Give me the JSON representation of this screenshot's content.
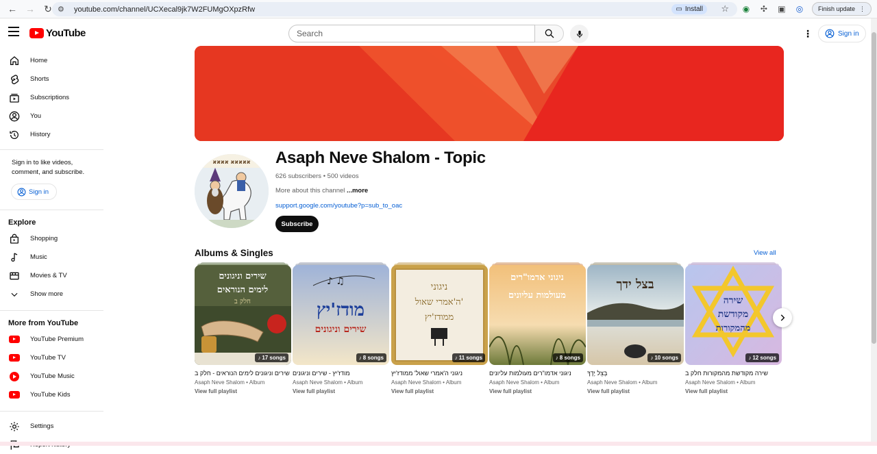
{
  "browser": {
    "url": "youtube.com/channel/UCXecal9jk7W2FUMgOXpzRfw",
    "install_label": "Install",
    "finish_update_label": "Finish update"
  },
  "header": {
    "logo_text": "YouTube",
    "search_placeholder": "Search",
    "signin_label": "Sign in"
  },
  "sidebar": {
    "main": [
      {
        "label": "Home",
        "icon": "home-icon"
      },
      {
        "label": "Shorts",
        "icon": "shorts-icon"
      },
      {
        "label": "Subscriptions",
        "icon": "subscriptions-icon"
      },
      {
        "label": "You",
        "icon": "you-icon"
      },
      {
        "label": "History",
        "icon": "history-icon"
      }
    ],
    "signin_note": "Sign in to like videos, comment, and subscribe.",
    "signin_label": "Sign in",
    "explore_heading": "Explore",
    "explore": [
      {
        "label": "Shopping",
        "icon": "shopping-icon"
      },
      {
        "label": "Music",
        "icon": "music-icon"
      },
      {
        "label": "Movies & TV",
        "icon": "movies-icon"
      },
      {
        "label": "Show more",
        "icon": "chevron-down-icon"
      }
    ],
    "more_heading": "More from YouTube",
    "more": [
      {
        "label": "YouTube Premium"
      },
      {
        "label": "YouTube TV"
      },
      {
        "label": "YouTube Music"
      },
      {
        "label": "YouTube Kids"
      }
    ],
    "bottom": [
      {
        "label": "Settings",
        "icon": "gear-icon"
      },
      {
        "label": "Report history",
        "icon": "flag-icon"
      }
    ]
  },
  "channel": {
    "name": "Asaph Neve Shalom - Topic",
    "meta": "626 subscribers • 500 videos",
    "description": "More about this channel",
    "more_label": "...more",
    "link": "support.google.com/youtube?p=sub_to_oac",
    "subscribe_label": "Subscribe"
  },
  "albums": {
    "title": "Albums & Singles",
    "view_all": "View all",
    "items": [
      {
        "title": "שירים וניגונים לימים הנוראים - חלק ב",
        "subtitle": "Asaph Neve Shalom • Album",
        "link": "View full playlist",
        "songs": "17 songs",
        "thumb_text_1": "שירים וניגונים",
        "thumb_text_2": "לימים הנוראים",
        "thumb_text_3": "חלק ב"
      },
      {
        "title": "מודז'יץ - שירים וניגונים",
        "subtitle": "Asaph Neve Shalom • Album",
        "link": "View full playlist",
        "songs": "8 songs",
        "thumb_text_1": "מודז'יץ",
        "thumb_text_2": "שירים וניגונים",
        "thumb_text_3": ""
      },
      {
        "title": "ניגוני ה'אמרי שאול' ממודז'יץ",
        "subtitle": "Asaph Neve Shalom • Album",
        "link": "View full playlist",
        "songs": "11 songs",
        "thumb_text_1": "ניגוני",
        "thumb_text_2": "ה'אמרי שאול'",
        "thumb_text_3": "ממודז'יץ"
      },
      {
        "title": "ניגוני אדמו\"רים מעולמות עליונים",
        "subtitle": "Asaph Neve Shalom • Album",
        "link": "View full playlist",
        "songs": "8 songs",
        "thumb_text_1": "ניגוני אדמו\"רים",
        "thumb_text_2": "מעולמות עליונים",
        "thumb_text_3": ""
      },
      {
        "title": "בְּצֵל יָדֶךָ",
        "subtitle": "Asaph Neve Shalom • Album",
        "link": "View full playlist",
        "songs": "10 songs",
        "thumb_text_1": "בצל ידך",
        "thumb_text_2": "",
        "thumb_text_3": ""
      },
      {
        "title": "שירה מקודשת מהמקורות חלק ב",
        "subtitle": "Asaph Neve Shalom • Album",
        "link": "View full playlist",
        "songs": "12 songs",
        "thumb_text_1": "שירה",
        "thumb_text_2": "מקודשת",
        "thumb_text_3": "מהמקורות"
      }
    ]
  },
  "colors": {
    "brand_red": "#ff0000",
    "link_blue": "#065fd4",
    "banner_red": "#ec3a1f"
  }
}
